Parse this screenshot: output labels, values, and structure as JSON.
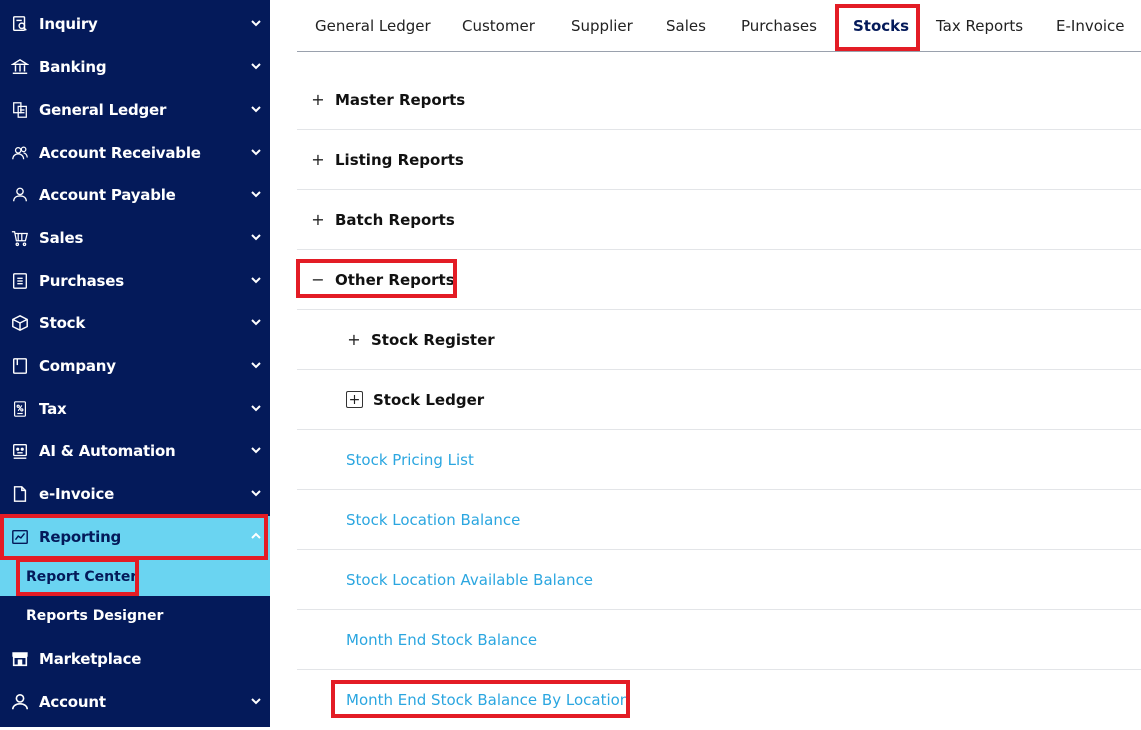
{
  "sidebar": {
    "items": [
      {
        "label": "Inquiry",
        "icon": "inquiry-icon"
      },
      {
        "label": "Banking",
        "icon": "bank-icon"
      },
      {
        "label": "General Ledger",
        "icon": "ledger-icon"
      },
      {
        "label": "Account Receivable",
        "icon": "users-icon"
      },
      {
        "label": "Account Payable",
        "icon": "user-icon"
      },
      {
        "label": "Sales",
        "icon": "cart-icon"
      },
      {
        "label": "Purchases",
        "icon": "receipt-icon"
      },
      {
        "label": "Stock",
        "icon": "box-icon"
      },
      {
        "label": "Company",
        "icon": "document-icon"
      },
      {
        "label": "Tax",
        "icon": "tax-icon"
      },
      {
        "label": "AI & Automation",
        "icon": "robot-icon"
      },
      {
        "label": "e-Invoice",
        "icon": "file-icon"
      },
      {
        "label": "Reporting",
        "icon": "chart-icon"
      }
    ],
    "sub_items": [
      {
        "label": "Report Center"
      },
      {
        "label": "Reports Designer"
      }
    ],
    "marketplace": {
      "label": "Marketplace",
      "icon": "store-icon"
    },
    "account": {
      "label": "Account",
      "icon": "account-icon"
    }
  },
  "tabs": [
    {
      "label": "General Ledger"
    },
    {
      "label": "Customer"
    },
    {
      "label": "Supplier"
    },
    {
      "label": "Sales"
    },
    {
      "label": "Purchases"
    },
    {
      "label": "Stocks"
    },
    {
      "label": "Tax Reports"
    },
    {
      "label": "E-Invoice"
    }
  ],
  "reports": {
    "groups": [
      {
        "label": "Master Reports",
        "toggle": "+"
      },
      {
        "label": "Listing Reports",
        "toggle": "+"
      },
      {
        "label": "Batch Reports",
        "toggle": "+"
      },
      {
        "label": "Other Reports",
        "toggle": "−"
      }
    ],
    "subgroups": [
      {
        "label": "Stock Register",
        "toggle": "+"
      },
      {
        "label": "Stock Ledger",
        "toggle": "+"
      }
    ],
    "links": [
      {
        "label": "Stock Pricing List"
      },
      {
        "label": "Stock Location Balance"
      },
      {
        "label": "Stock Location Available Balance"
      },
      {
        "label": "Month End Stock Balance"
      },
      {
        "label": "Month End Stock Balance By Location"
      }
    ]
  },
  "colors": {
    "sidebar_bg": "#041a5a",
    "active_bg": "#6ad4f1",
    "highlight": "#e31c25",
    "link": "#2ba6e0"
  }
}
